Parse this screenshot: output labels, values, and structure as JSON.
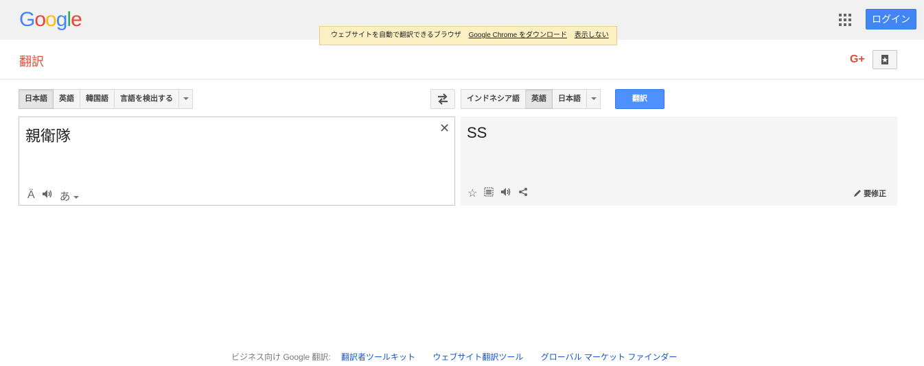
{
  "header": {
    "logo_letters": [
      "G",
      "o",
      "o",
      "g",
      "l",
      "e"
    ],
    "logo_colors": [
      "#4285f4",
      "#ea4335",
      "#fbbc05",
      "#4285f4",
      "#34a853",
      "#ea4335"
    ],
    "login_label": "ログイン"
  },
  "notice": {
    "text": "ウェブサイトを自動で翻訳できるブラウザ",
    "download_link": "Google Chrome をダウンロード",
    "dismiss_link": "表示しない"
  },
  "subheader": {
    "title": "翻訳",
    "gplus_label": "G+"
  },
  "source": {
    "languages": [
      "日本語",
      "英語",
      "韓国語",
      "言語を検出する"
    ],
    "selected": "日本語",
    "text": "親衛隊",
    "clear_symbol": "✕"
  },
  "target": {
    "languages": [
      "インドネシア語",
      "英語",
      "日本語"
    ],
    "selected": "英語",
    "text": "SS",
    "edit_label": "要修正"
  },
  "translate_label": "翻訳",
  "footer": {
    "prefix": "ビジネス向け Google 翻訳:",
    "links": [
      "翻訳者ツールキット",
      "ウェブサイト翻訳ツール",
      "グローバル マーケット ファインダー"
    ]
  },
  "colors": {
    "accent": "#4285f4",
    "title_red": "#dd4b39",
    "notice_bg": "#fcefc2"
  }
}
